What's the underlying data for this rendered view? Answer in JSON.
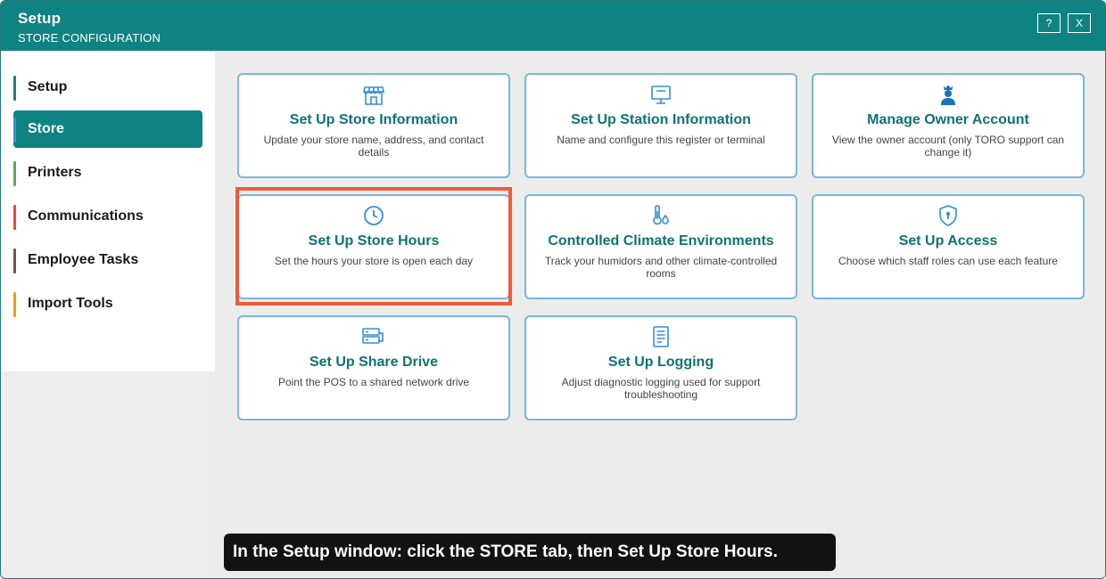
{
  "window": {
    "title": "Setup",
    "subtitle": "STORE CONFIGURATION",
    "help_label": "?",
    "close_label": "X"
  },
  "sidebar": {
    "items": [
      {
        "label": "Setup",
        "color": "#0f8381",
        "active": false
      },
      {
        "label": "Store",
        "color": "#3b8fd6",
        "active": true
      },
      {
        "label": "Printers",
        "color": "#4caf50",
        "active": false
      },
      {
        "label": "Communications",
        "color": "#f44336",
        "active": false
      },
      {
        "label": "Employee Tasks",
        "color": "#795548",
        "active": false
      },
      {
        "label": "Import Tools",
        "color": "#ff9800",
        "active": false
      }
    ]
  },
  "cards": [
    {
      "title": "Set Up Store Information",
      "desc": "Update your store name, address, and contact details",
      "icon": "storefront-icon"
    },
    {
      "title": "Set Up Station Information",
      "desc": "Name and configure this register or terminal",
      "icon": "monitor-icon"
    },
    {
      "title": "Manage Owner Account",
      "desc": "View the owner account (only TORO support can change it)",
      "icon": "crowned-user-icon"
    },
    {
      "title": "Set Up Store Hours",
      "desc": "Set the hours your store is open each day",
      "icon": "clock-icon"
    },
    {
      "title": "Controlled Climate Environments",
      "desc": "Track your humidors and other climate-controlled rooms",
      "icon": "thermometer-droplet-icon"
    },
    {
      "title": "Set Up Access",
      "desc": "Choose which staff roles can use each feature",
      "icon": "shield-keyhole-icon"
    },
    {
      "title": "Set Up Share Drive",
      "desc": "Point the POS to a shared network drive",
      "icon": "network-drive-icon"
    },
    {
      "title": "Set Up Logging",
      "desc": "Adjust diagnostic logging used for support troubleshooting",
      "icon": "document-lines-icon"
    }
  ],
  "caption": "In the Setup window: click the STORE tab, then Set Up Store Hours.",
  "colors": {
    "teal": "#0f8381",
    "card_border": "#75b7e6",
    "icon_blue": "#2f8fdc",
    "highlight": "#f05a3a"
  }
}
